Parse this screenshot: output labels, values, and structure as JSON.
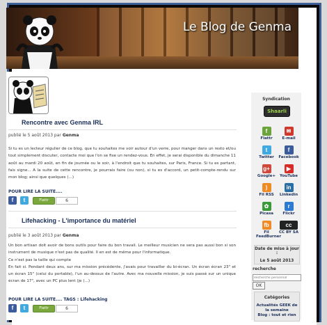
{
  "blog": {
    "title": "Le Blog de Genma"
  },
  "posts": [
    {
      "title": "Rencontre avec Genma IRL",
      "meta_prefix": "publié le 5 août 2013 par",
      "author": "Genma",
      "body": "Si tu es un lecteur régulier de ce blog, que tu souhaites me voir autour d'un verre, pour manger dans un resto et/ou tout simplement discuter, contacte moi que l'on se fixe un rendez-vous. En effet, je serai disponible du dimanche 11 août au mardi 20 août, en fin de journée ou le soir, à l'endroit que tu souhaites, sur Paris, France. Si tu es partant, fais signe... A la suite de cette rencontre, je pourrais faire (ou non), si tu es d'accord, un petit-compte-rendu sur mon blog; ainsi que quelques (...)",
      "more": "POUR LIRE LA SUITE....",
      "flattr": "Flattr",
      "count": "6"
    },
    {
      "title": "Lifehacking - L'importance du matériel",
      "meta_prefix": "publié le 3 août 2013 par",
      "author": "Genma",
      "body_lines": [
        "Un bon artisan doit avoir de bons outils pour faire du bon travail. Le meilleur musicien ne sera pas aussi bon si son instrument de musique n'est pas de qualité. Il en est de même pour l'informatique.",
        "Ce n'est pas la taille qui compte",
        "En fait si. Pendant deux ans, sur ma mission précédente, j'avais pour travailler du bi-écran. Un écran écran 23\" et un écran 15\" (celui du portable), l'un au-dessus de l'autre. Avec ma nouvelle mission, je suis passé sur un unique écran de 17\", avec un PC plus lent (je (...)"
      ],
      "more": "POUR LIRE LA SUITE.... TAGS :",
      "tag": "Lifehacking",
      "flattr": "Flattr",
      "count": "6"
    }
  ],
  "sidebar": {
    "syndication_title": "Syndication",
    "shaarli_label": "Shaarli",
    "social": [
      {
        "label": "Flattr",
        "icon": "flattr-icon",
        "color": "#6ba43a",
        "glyph": "f"
      },
      {
        "label": "E-mail",
        "icon": "email-icon",
        "color": "#d0382c",
        "glyph": "✉"
      },
      {
        "label": "Twitter",
        "icon": "twitter-icon",
        "color": "#3fa9e0",
        "glyph": "t"
      },
      {
        "label": "Facebook",
        "icon": "facebook-icon",
        "color": "#3b5b9b",
        "glyph": "f"
      },
      {
        "label": "Google+",
        "icon": "googleplus-icon",
        "color": "#d1473a",
        "glyph": "g+"
      },
      {
        "label": "YouTube",
        "icon": "youtube-icon",
        "color": "#d62b26",
        "glyph": "▶"
      },
      {
        "label": "Fil RSS",
        "icon": "rss-icon",
        "color": "#f08a24",
        "glyph": ")"
      },
      {
        "label": "Linkedin",
        "icon": "linkedin-icon",
        "color": "#2a6ea6",
        "glyph": "in"
      },
      {
        "label": "Picasa",
        "icon": "picasa-icon",
        "color": "#3a9a3a",
        "glyph": "✿"
      },
      {
        "label": "Flickr",
        "icon": "flickr-icon",
        "color": "#2a7bd1",
        "glyph": "r"
      },
      {
        "label": "Fil FeedBurner",
        "icon": "feedburner-icon",
        "color": "#f08a24",
        "glyph": "fb"
      },
      {
        "label": "CC BY SA",
        "icon": "cc-by-sa-icon",
        "color": "#222222",
        "glyph": "cc"
      }
    ],
    "update_title": "Date de mise à jour :",
    "update_date": "Le 5 août 2013",
    "search_title": "recherche",
    "search_placeholder": "Recherche personnal",
    "search_button": "OK",
    "categories_title": "Catégories",
    "categories": [
      "Actualités GEEK de la semaine",
      "Blog : tout et rien"
    ]
  }
}
